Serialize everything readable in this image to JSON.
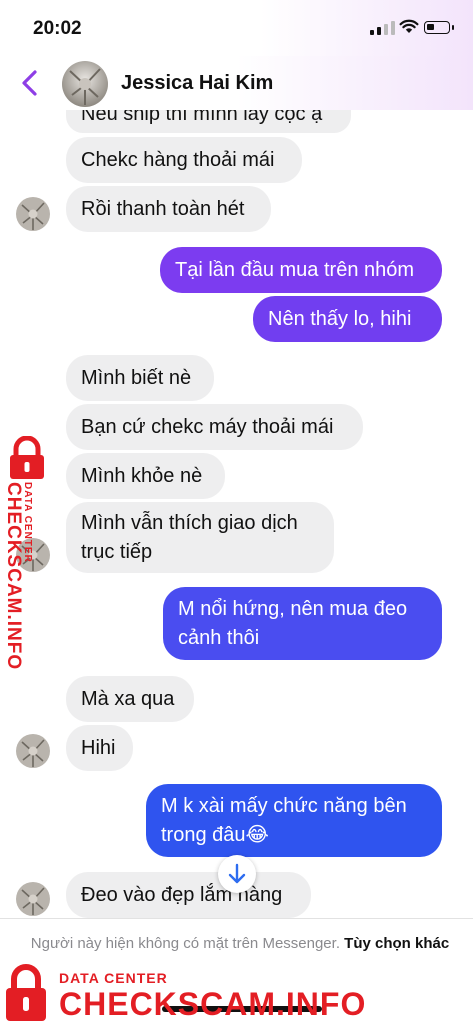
{
  "status_bar": {
    "time": "20:02",
    "battery_level": 0.35
  },
  "header": {
    "contact_name": "Jessica Hai Kim"
  },
  "messages": [
    {
      "direction": "incoming",
      "text": "Nếu ship thì mình lấy cọc ạ"
    },
    {
      "direction": "incoming",
      "text": "Chekc hàng thoải mái"
    },
    {
      "direction": "incoming",
      "text": "Rồi thanh toàn hét"
    },
    {
      "direction": "outgoing",
      "text": "Tại lần đầu mua trên nhóm"
    },
    {
      "direction": "outgoing",
      "text": "Nên thấy lo,  hihi"
    },
    {
      "direction": "incoming",
      "text": "Mình biết nè"
    },
    {
      "direction": "incoming",
      "text": "Bạn cứ chekc máy thoải mái"
    },
    {
      "direction": "incoming",
      "text": "Mình khỏe nè"
    },
    {
      "direction": "incoming",
      "text": "Mình vẫn thích giao dịch\ntrục tiếp"
    },
    {
      "direction": "outgoing",
      "text": "M nổi hứng, nên mua đeo\ncảnh thôi"
    },
    {
      "direction": "incoming",
      "text": "Mà xa qua"
    },
    {
      "direction": "incoming",
      "text": "Hihi"
    },
    {
      "direction": "outgoing",
      "text": "M k xài mấy chức năng bên\ntrong đâu😂"
    },
    {
      "direction": "incoming",
      "text": "Đeo vào đẹp lắm nàng"
    }
  ],
  "footer": {
    "notice": "Người này hiện không có mặt trên Messenger.",
    "more_options": "Tùy chọn khác"
  },
  "watermark": {
    "line1": "DATA CENTER",
    "line2": "CHECKSCAM.INFO"
  },
  "colors": {
    "outgoing_top": "#7b3cf0",
    "outgoing_bottom": "#2d55ef",
    "incoming": "#eeeeef",
    "accent": "#8e3ee6",
    "watermark": "#e31e24"
  }
}
